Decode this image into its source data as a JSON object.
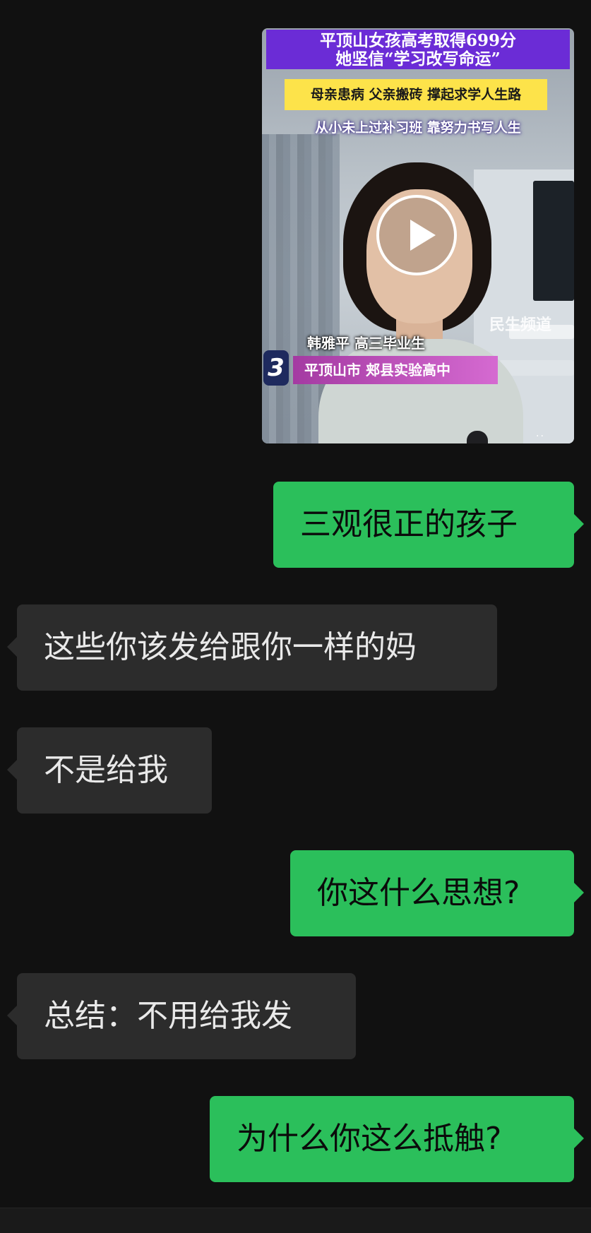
{
  "video": {
    "headline_line1": "平顶山女孩高考取得699分",
    "headline_line2": "她坚信“学习改写命运”",
    "subheadline": "母亲患病 父亲搬砖 撑起求学人生路",
    "tagline": "从小未上过补习班  靠努力书写人生",
    "watermark": "民生频道",
    "person_name": "韩雅平 高三毕业生",
    "school": "平顶山市 郏县实验高中",
    "channel_badge": "3"
  },
  "messages": [
    {
      "side": "right",
      "text": "三观很正的孩子"
    },
    {
      "side": "left",
      "text": "这些你该发给跟你一样的妈"
    },
    {
      "side": "left",
      "text": "不是给我"
    },
    {
      "side": "right",
      "text": "你这什么思想?"
    },
    {
      "side": "left",
      "text": "总结：不用给我发"
    },
    {
      "side": "right",
      "text": "为什么你这么抵触?"
    }
  ]
}
